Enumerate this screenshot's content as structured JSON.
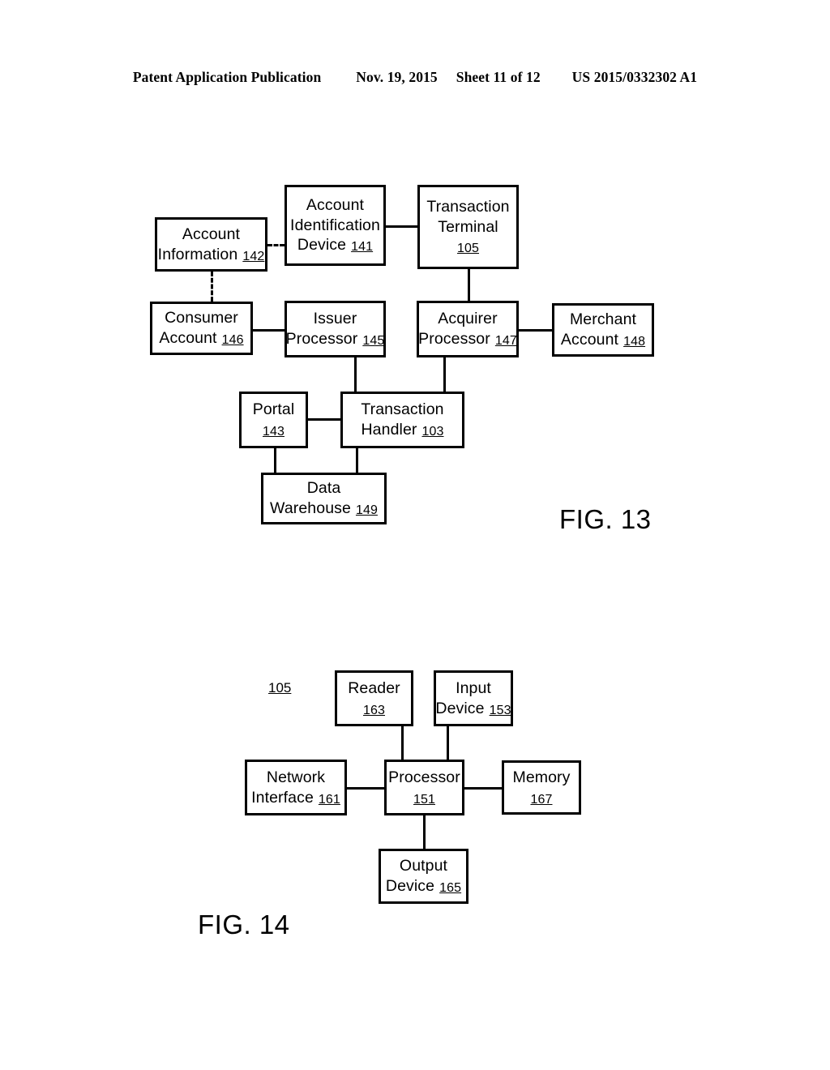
{
  "header": {
    "publication": "Patent Application Publication",
    "date": "Nov. 19, 2015",
    "sheet": "Sheet 11 of 12",
    "patent_number": "US 2015/0332302 A1"
  },
  "figures": [
    {
      "caption": "FIG. 13",
      "nodes": {
        "account_information": {
          "line1": "Account",
          "line2": "Information",
          "ref": "142"
        },
        "account_identification_device": {
          "line1": "Account",
          "line2": "Identification",
          "line3": "Device",
          "ref": "141"
        },
        "transaction_terminal": {
          "line1": "Transaction",
          "line2": "Terminal",
          "ref": "105"
        },
        "consumer_account": {
          "line1": "Consumer",
          "line2": "Account",
          "ref": "146"
        },
        "issuer_processor": {
          "line1": "Issuer",
          "line2": "Processor",
          "ref": "145"
        },
        "acquirer_processor": {
          "line1": "Acquirer",
          "line2": "Processor",
          "ref": "147"
        },
        "merchant_account": {
          "line1": "Merchant",
          "line2": "Account",
          "ref": "148"
        },
        "portal": {
          "line1": "Portal",
          "ref": "143"
        },
        "transaction_handler": {
          "line1": "Transaction",
          "line2": "Handler",
          "ref": "103"
        },
        "data_warehouse": {
          "line1": "Data",
          "line2": "Warehouse",
          "ref": "149"
        }
      }
    },
    {
      "caption": "FIG. 14",
      "system_ref": "105",
      "nodes": {
        "reader": {
          "line1": "Reader",
          "ref": "163"
        },
        "input_device": {
          "line1": "Input",
          "line2": "Device",
          "ref": "153"
        },
        "network_interface": {
          "line1": "Network",
          "line2": "Interface",
          "ref": "161"
        },
        "processor": {
          "line1": "Processor",
          "ref": "151"
        },
        "memory": {
          "line1": "Memory",
          "ref": "167"
        },
        "output_device": {
          "line1": "Output",
          "line2": "Device",
          "ref": "165"
        }
      }
    }
  ],
  "colors": {
    "ink": "#000000",
    "paper": "#ffffff"
  }
}
